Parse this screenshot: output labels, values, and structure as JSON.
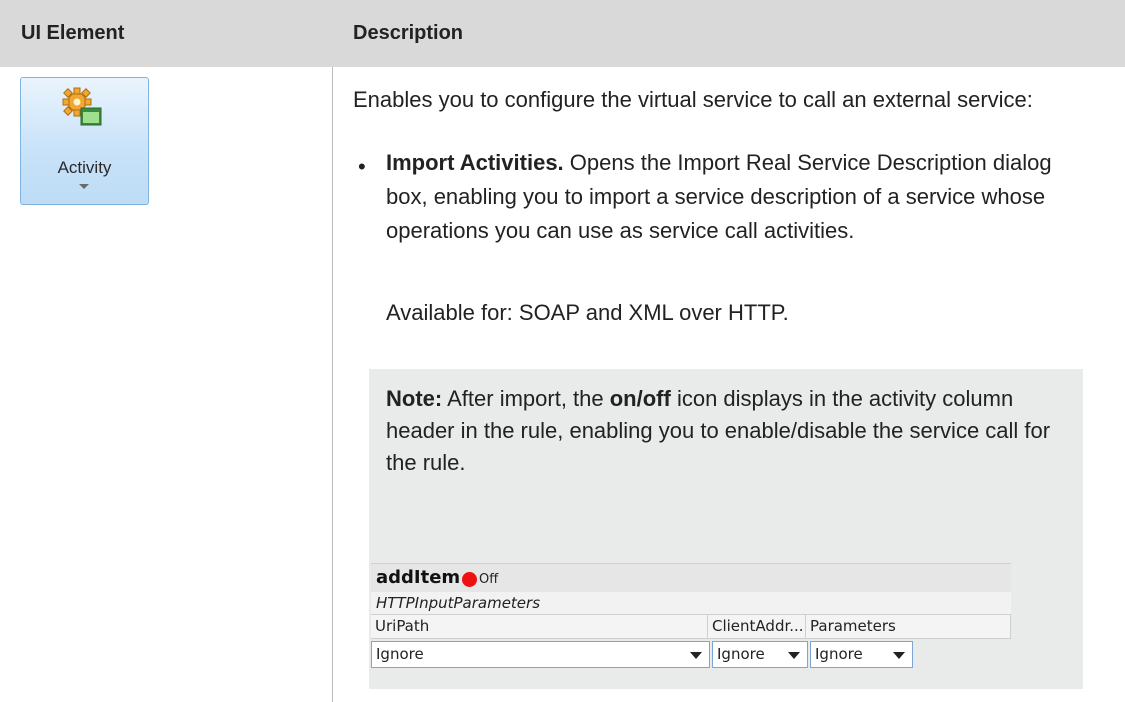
{
  "table": {
    "headers": [
      "UI Element",
      "Description"
    ]
  },
  "ribbon_button": {
    "label": "Activity",
    "icon": "gear-folder-icon"
  },
  "description": {
    "intro": "Enables you to configure the virtual service to call an external service:",
    "bullet_title": "Import Activities.",
    "bullet_text": " Opens the Import Real Service Description dialog box, enabling you to import a service description of a service whose operations you can use as service call activities.",
    "available": "Available for: SOAP and XML over HTTP."
  },
  "note": {
    "label": "Note:",
    "text_before": " After import, the ",
    "bold_word": "on/off",
    "text_after": " icon displays in the activity column header in the rule, enabling you to enable/disable the service call for the rule."
  },
  "grid": {
    "title": "addItem",
    "status": "Off",
    "status_color": "#ee1111",
    "subtitle": "HTTPInputParameters",
    "columns": [
      "UriPath",
      "ClientAddr...",
      "Parameters"
    ],
    "values": [
      "Ignore",
      "Ignore",
      "Ignore"
    ]
  }
}
